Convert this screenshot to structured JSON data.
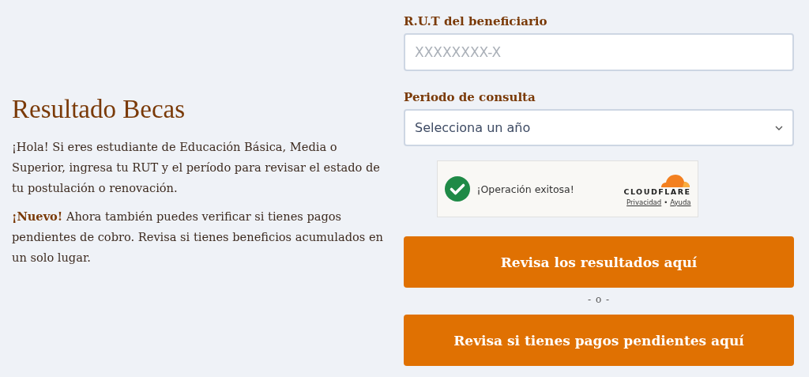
{
  "intro": {
    "title": "Resultado Becas",
    "paragraphs": [
      "¡Hola! Si eres estudiante de Educación Básica, Media o Superior, ingresa tu RUT y el período para revisar el estado de tu postulación o renovación.",
      "**¡Nuevo!** Ahora también puedes verificar si tienes pagos pendientes de cobro. Revisa si tienes beneficios acumulados en un solo lugar."
    ]
  },
  "form": {
    "rut": {
      "label": "R.U.T del beneficiario",
      "placeholder": "XXXXXXXX-X"
    },
    "period": {
      "label": "Periodo de consulta",
      "value": "Selecciona un año"
    },
    "captcha": {
      "status": "¡Operación exitosa!",
      "verified": true,
      "brand": "CLOUDFLARE",
      "links": [
        "Privacidad",
        "Ayuda"
      ],
      "separator": "•"
    },
    "buttons": [
      {
        "label": "Revisa los resultados aquí"
      },
      {
        "label": "Revisa si tienes pagos pendientes aquí"
      }
    ],
    "divider": "- o -"
  }
}
